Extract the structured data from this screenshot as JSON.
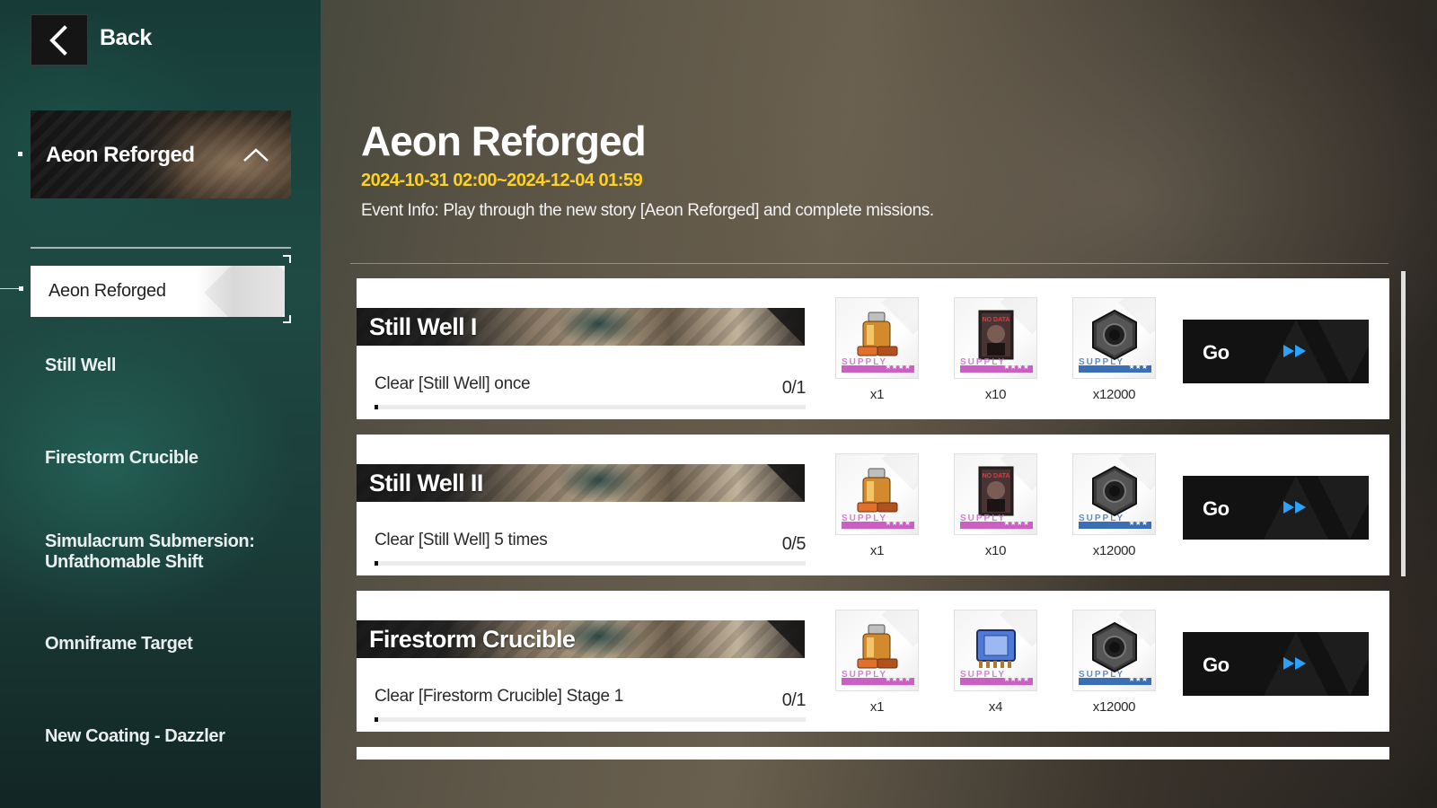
{
  "nav": {
    "back_label": "Back"
  },
  "sidebar": {
    "event_card_label": "Aeon Reforged",
    "active_item": "Aeon Reforged",
    "items": [
      {
        "label": "Still Well"
      },
      {
        "label": "Firestorm Crucible"
      },
      {
        "label": "Simulacrum Submersion:\nUnfathomable Shift"
      },
      {
        "label": "Omniframe Target"
      },
      {
        "label": "New Coating - Dazzler"
      }
    ]
  },
  "header": {
    "title": "Aeon Reforged",
    "dates": "2024-10-31 02:00~2024-12-04 01:59",
    "info": "Event Info: Play through the new story [Aeon Reforged] and complete missions."
  },
  "missions": [
    {
      "title": "Still Well I",
      "task": "Clear [Still Well] once",
      "progress": "0/1",
      "progress_fraction": 0.0,
      "rewards": [
        {
          "icon": "battery-icon",
          "count": "x1",
          "rarity_color": "#cc5fc4"
        },
        {
          "icon": "no-data-card-icon",
          "count": "x10",
          "rarity_color": "#cc5fc4"
        },
        {
          "icon": "hex-nut-icon",
          "count": "x12000",
          "rarity_color": "#3b6fb5"
        }
      ],
      "go_label": "Go"
    },
    {
      "title": "Still Well II",
      "task": "Clear [Still Well] 5 times",
      "progress": "0/5",
      "progress_fraction": 0.0,
      "rewards": [
        {
          "icon": "battery-icon",
          "count": "x1",
          "rarity_color": "#cc5fc4"
        },
        {
          "icon": "no-data-card-icon",
          "count": "x10",
          "rarity_color": "#cc5fc4"
        },
        {
          "icon": "hex-nut-icon",
          "count": "x12000",
          "rarity_color": "#3b6fb5"
        }
      ],
      "go_label": "Go"
    },
    {
      "title": "Firestorm Crucible",
      "task": "Clear [Firestorm Crucible] Stage 1",
      "progress": "0/1",
      "progress_fraction": 0.0,
      "rewards": [
        {
          "icon": "battery-icon",
          "count": "x1",
          "rarity_color": "#cc5fc4"
        },
        {
          "icon": "chip-icon",
          "count": "x4",
          "rarity_color": "#cc5fc4"
        },
        {
          "icon": "hex-nut-icon",
          "count": "x12000",
          "rarity_color": "#3b6fb5"
        }
      ],
      "go_label": "Go"
    }
  ],
  "reward_ui": {
    "supply_text": "SUPPLY",
    "stars_4": "★★★★",
    "stars_3": "★★★"
  },
  "colors": {
    "accent_yellow": "#ffd21f",
    "go_arrow": "#2aa3ff",
    "rarity_purple": "#cc5fc4",
    "rarity_blue": "#3b6fb5"
  }
}
